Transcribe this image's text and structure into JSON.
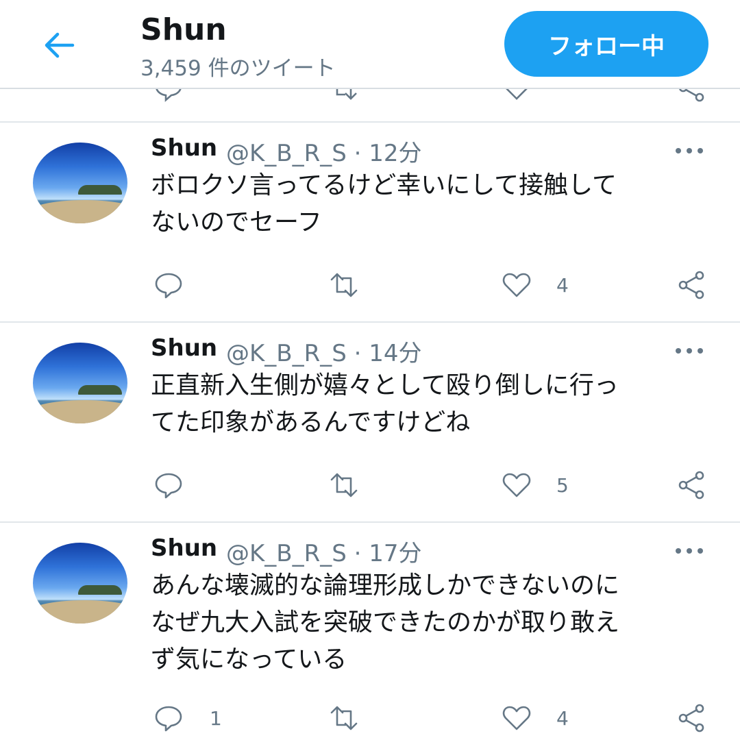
{
  "header": {
    "title": "Shun",
    "tweet_count": "3,459 件のツイート",
    "follow_label": "フォロー中"
  },
  "tweets": [
    {
      "name": "Shun",
      "meta": "@K_B_R_S · 12分",
      "text": "ボロクソ言ってるけど幸いにして接触して\nないのでセーフ",
      "reply_count": "",
      "like_count": "4"
    },
    {
      "name": "Shun",
      "meta": "@K_B_R_S · 14分",
      "text": "正直新入生側が嬉々として殴り倒しに行っ\nてた印象があるんですけどね",
      "reply_count": "",
      "like_count": "5"
    },
    {
      "name": "Shun",
      "meta": "@K_B_R_S · 17分",
      "text": "あんな壊滅的な論理形成しかできないのに\nなぜ九大入試を突破できたのかが取り敢え\nず気になっている",
      "reply_count": "1",
      "like_count": "4"
    }
  ],
  "icons": {
    "back": "arrow-left-icon",
    "reply": "speech-bubble-icon",
    "retweet": "retweet-icon",
    "like": "heart-icon",
    "share": "share-icon",
    "more": "ellipsis-icon"
  },
  "colors": {
    "accent": "#1da1f2",
    "text": "#14171a",
    "secondary": "#657786",
    "divider": "#e1e6ea"
  }
}
